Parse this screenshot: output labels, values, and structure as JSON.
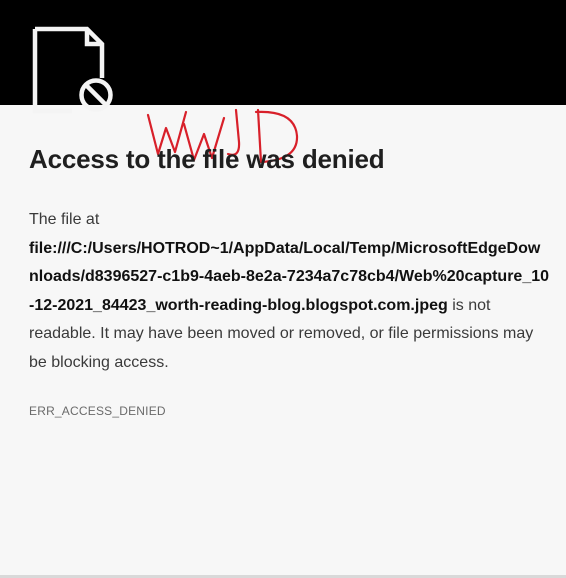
{
  "error_page": {
    "icon": "file-blocked-icon",
    "annotation_scrawl": "WWJD",
    "title": "Access to the file was denied",
    "message_prefix": "The file at",
    "file_path": "file:///C:/Users/HOTROD~1/AppData/Local/Temp/MicrosoftEdgeDownloads/d8396527-c1b9-4aeb-8e2a-7234a7c78cb4/Web%20capture_10-12-2021_84423_worth-reading-blog.blogspot.com.jpeg",
    "message_suffix": "is not readable. It may have been moved or removed, or file permissions may be blocking access.",
    "error_code": "ERR_ACCESS_DENIED"
  },
  "colors": {
    "top_band": "#000000",
    "page_background": "#f7f7f7",
    "title_text": "#1f1f1f",
    "annotation_ink": "#d8202a"
  }
}
